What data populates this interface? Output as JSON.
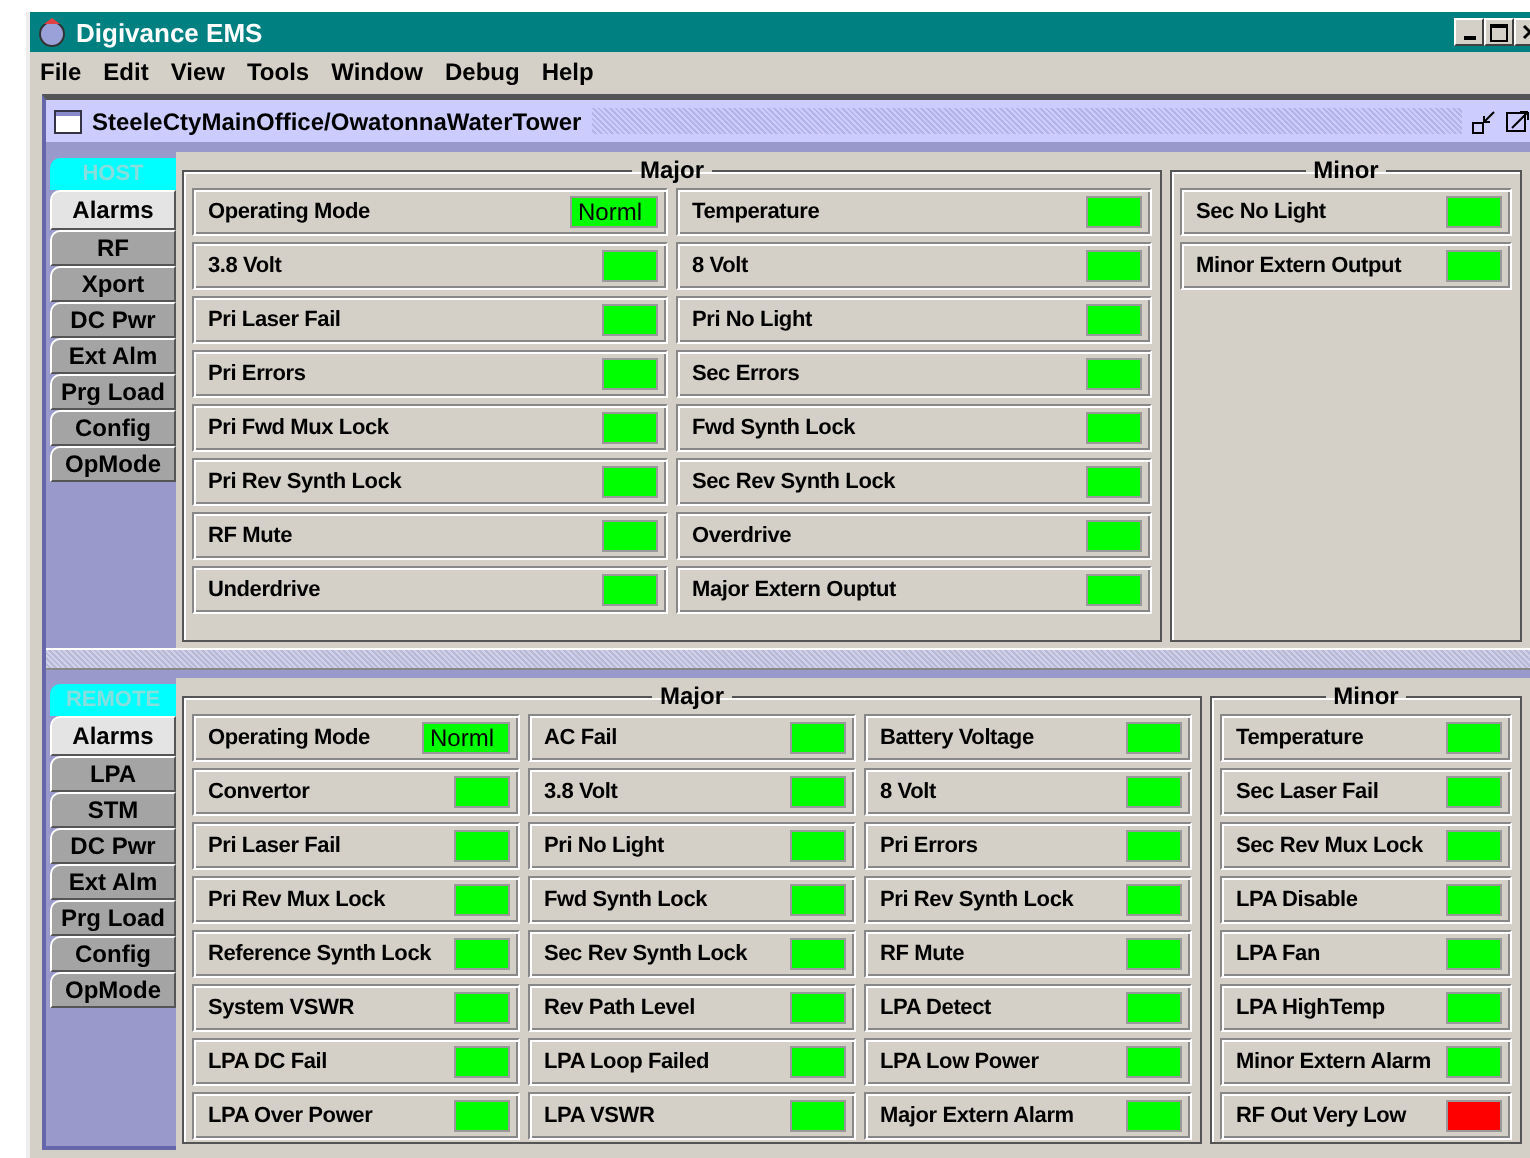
{
  "window": {
    "title": "Digivance EMS"
  },
  "menu": [
    "File",
    "Edit",
    "View",
    "Tools",
    "Window",
    "Debug",
    "Help"
  ],
  "frame": {
    "title": "SteeleCtyMainOffice/OwatonnaWaterTower"
  },
  "panels": [
    {
      "header": "HOST",
      "tabs": [
        {
          "label": "Alarms",
          "selected": true
        },
        {
          "label": "RF",
          "selected": false
        },
        {
          "label": "Xport",
          "selected": false
        },
        {
          "label": "DC Pwr",
          "selected": false
        },
        {
          "label": "Ext Alm",
          "selected": false
        },
        {
          "label": "Prg Load",
          "selected": false
        },
        {
          "label": "Config",
          "selected": false
        },
        {
          "label": "OpMode",
          "selected": false
        }
      ],
      "major": {
        "title": "Major",
        "items": [
          {
            "label": "Operating Mode",
            "value": "Norml",
            "color": "#00ff00"
          },
          {
            "label": "Temperature",
            "color": "#00ff00"
          },
          {
            "label": "3.8 Volt",
            "color": "#00ff00"
          },
          {
            "label": "8 Volt",
            "color": "#00ff00"
          },
          {
            "label": "Pri Laser Fail",
            "color": "#00ff00"
          },
          {
            "label": "Pri No Light",
            "color": "#00ff00"
          },
          {
            "label": "Pri Errors",
            "color": "#00ff00"
          },
          {
            "label": "Sec Errors",
            "color": "#00ff00"
          },
          {
            "label": "Pri Fwd Mux Lock",
            "color": "#00ff00"
          },
          {
            "label": "Fwd Synth Lock",
            "color": "#00ff00"
          },
          {
            "label": "Pri Rev Synth Lock",
            "color": "#00ff00"
          },
          {
            "label": "Sec Rev Synth Lock",
            "color": "#00ff00"
          },
          {
            "label": "RF Mute",
            "color": "#00ff00"
          },
          {
            "label": "Overdrive",
            "color": "#00ff00"
          },
          {
            "label": "Underdrive",
            "color": "#00ff00"
          },
          {
            "label": "Major Extern Ouptut",
            "color": "#00ff00"
          }
        ]
      },
      "minor": {
        "title": "Minor",
        "items": [
          {
            "label": "Sec No Light",
            "color": "#00ff00"
          },
          {
            "label": "Minor Extern Output",
            "color": "#00ff00"
          }
        ]
      }
    },
    {
      "header": "REMOTE",
      "tabs": [
        {
          "label": "Alarms",
          "selected": true
        },
        {
          "label": "LPA",
          "selected": false
        },
        {
          "label": "STM",
          "selected": false
        },
        {
          "label": "DC Pwr",
          "selected": false
        },
        {
          "label": "Ext Alm",
          "selected": false
        },
        {
          "label": "Prg Load",
          "selected": false
        },
        {
          "label": "Config",
          "selected": false
        },
        {
          "label": "OpMode",
          "selected": false
        }
      ],
      "major": {
        "title": "Major",
        "items": [
          {
            "label": "Operating Mode",
            "value": "Norml",
            "color": "#00ff00"
          },
          {
            "label": "AC Fail",
            "color": "#00ff00"
          },
          {
            "label": "Battery Voltage",
            "color": "#00ff00"
          },
          {
            "label": "Convertor",
            "color": "#00ff00"
          },
          {
            "label": "3.8 Volt",
            "color": "#00ff00"
          },
          {
            "label": "8 Volt",
            "color": "#00ff00"
          },
          {
            "label": "Pri Laser Fail",
            "color": "#00ff00"
          },
          {
            "label": "Pri No Light",
            "color": "#00ff00"
          },
          {
            "label": "Pri Errors",
            "color": "#00ff00"
          },
          {
            "label": "Pri Rev Mux Lock",
            "color": "#00ff00"
          },
          {
            "label": "Fwd Synth Lock",
            "color": "#00ff00"
          },
          {
            "label": "Pri Rev Synth Lock",
            "color": "#00ff00"
          },
          {
            "label": "Reference Synth Lock",
            "color": "#00ff00"
          },
          {
            "label": "Sec Rev Synth Lock",
            "color": "#00ff00"
          },
          {
            "label": "RF Mute",
            "color": "#00ff00"
          },
          {
            "label": "System VSWR",
            "color": "#00ff00"
          },
          {
            "label": "Rev Path Level",
            "color": "#00ff00"
          },
          {
            "label": "LPA Detect",
            "color": "#00ff00"
          },
          {
            "label": "LPA DC Fail",
            "color": "#00ff00"
          },
          {
            "label": "LPA Loop Failed",
            "color": "#00ff00"
          },
          {
            "label": "LPA Low Power",
            "color": "#00ff00"
          },
          {
            "label": "LPA Over Power",
            "color": "#00ff00"
          },
          {
            "label": "LPA VSWR",
            "color": "#00ff00"
          },
          {
            "label": "Major Extern Alarm",
            "color": "#00ff00"
          }
        ]
      },
      "minor": {
        "title": "Minor",
        "items": [
          {
            "label": "Temperature",
            "color": "#00ff00"
          },
          {
            "label": "Sec Laser Fail",
            "color": "#00ff00"
          },
          {
            "label": "Sec Rev Mux Lock",
            "color": "#00ff00"
          },
          {
            "label": "LPA Disable",
            "color": "#00ff00"
          },
          {
            "label": "LPA Fan",
            "color": "#00ff00"
          },
          {
            "label": "LPA HighTemp",
            "color": "#00ff00"
          },
          {
            "label": "Minor Extern Alarm",
            "color": "#00ff00"
          },
          {
            "label": "RF Out Very Low",
            "color": "#ff0000"
          }
        ]
      }
    }
  ]
}
